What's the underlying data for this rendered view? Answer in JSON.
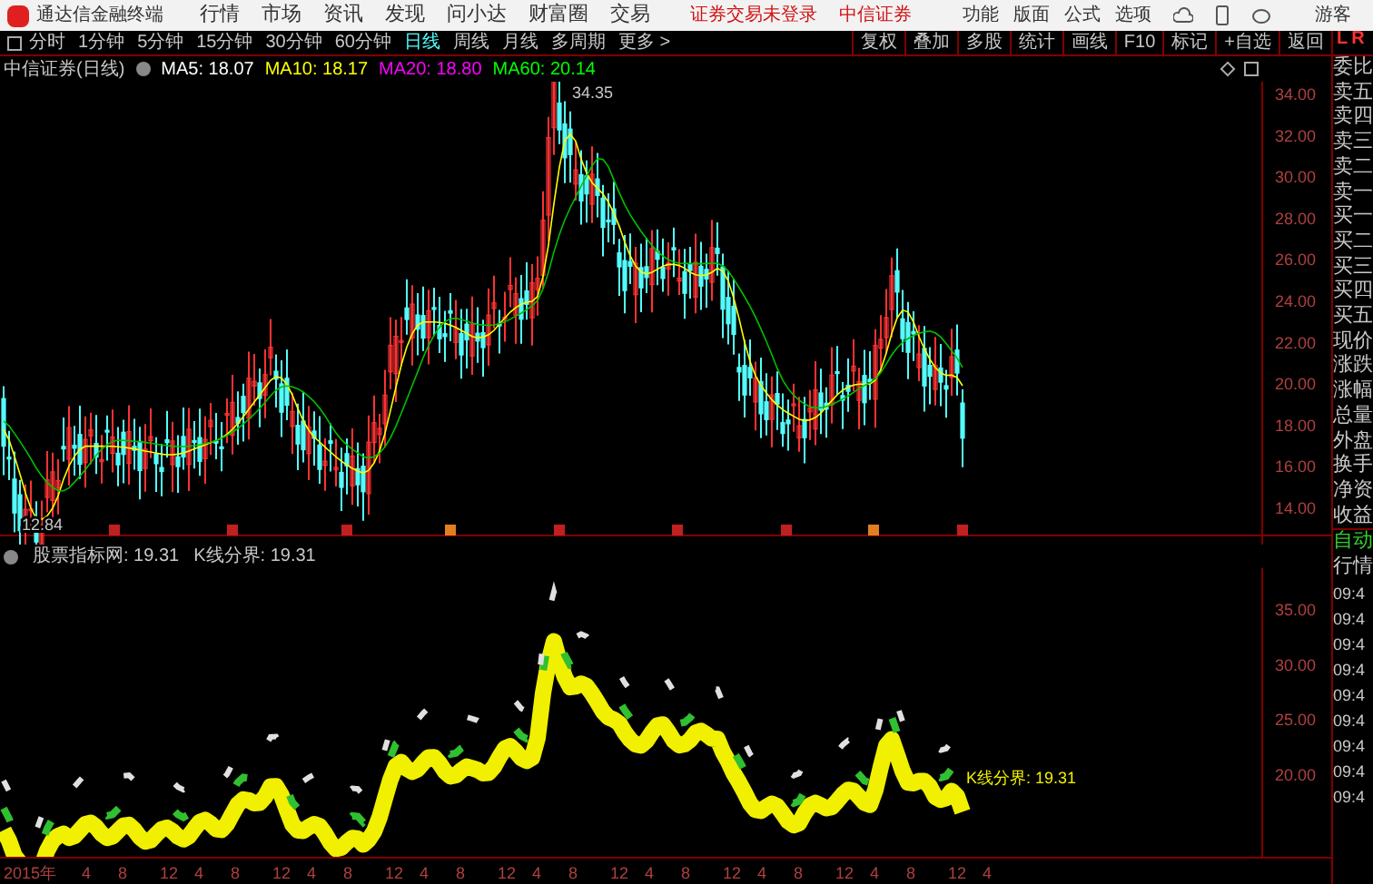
{
  "title_bar": {
    "app_name": "通达信金融终端",
    "menus": [
      "行情",
      "市场",
      "资讯",
      "发现",
      "问小达",
      "财富圈",
      "交易"
    ],
    "login_status": "证券交易未登录",
    "broker": "中信证券",
    "tools": [
      "功能",
      "版面",
      "公式",
      "选项"
    ],
    "user": "游客"
  },
  "period_tabs": [
    {
      "label": "分时",
      "selected": false
    },
    {
      "label": "1分钟",
      "selected": false
    },
    {
      "label": "5分钟",
      "selected": false
    },
    {
      "label": "15分钟",
      "selected": false
    },
    {
      "label": "30分钟",
      "selected": false
    },
    {
      "label": "60分钟",
      "selected": false
    },
    {
      "label": "日线",
      "selected": true
    },
    {
      "label": "周线",
      "selected": false
    },
    {
      "label": "月线",
      "selected": false
    },
    {
      "label": "多周期",
      "selected": false
    },
    {
      "label": "更多 >",
      "selected": false
    }
  ],
  "toolbar_buttons": [
    "复权",
    "叠加",
    "多股",
    "统计",
    "画线",
    "F10",
    "标记",
    "+自选",
    "返回"
  ],
  "side_tabs": [
    "L",
    "R"
  ],
  "legend": {
    "stock": "中信证券(日线)",
    "mas": [
      {
        "label": "MA5: 18.07",
        "color": "#ffffff"
      },
      {
        "label": "MA10: 18.17",
        "color": "#ffff00"
      },
      {
        "label": "MA20: 18.80",
        "color": "#ff00ff"
      },
      {
        "label": "MA60: 20.14",
        "color": "#00ff00"
      }
    ]
  },
  "main_chart": {
    "high_label": "34.35",
    "low_label": "12.84",
    "price_ticks": [
      "34.00",
      "32.00",
      "30.00",
      "28.00",
      "26.00",
      "24.00",
      "22.00",
      "20.00",
      "18.00",
      "16.00",
      "14.00"
    ]
  },
  "indicator": {
    "name": "股票指标网: 19.31",
    "value": "K线分界: 19.31",
    "line_label": "K线分界: 19.31",
    "ticks": [
      "35.00",
      "30.00",
      "25.00",
      "20.00"
    ]
  },
  "date_axis": [
    "2015年",
    "4",
    "8",
    "12",
    "4",
    "8",
    "12",
    "4",
    "8",
    "12",
    "4",
    "8",
    "12",
    "4",
    "8",
    "12",
    "4",
    "8",
    "12",
    "4",
    "8",
    "12",
    "4",
    "8",
    "12",
    "4"
  ],
  "quote_panel": {
    "labels": [
      "委比",
      "卖五",
      "卖四",
      "卖三",
      "卖二",
      "卖一",
      "买一",
      "买二",
      "买三",
      "买四",
      "买五",
      "现价",
      "涨跌",
      "涨幅",
      "总量",
      "外盘",
      "换手",
      "净资",
      "收益"
    ],
    "auto": "自动",
    "quote": "行情",
    "times": [
      "09:4",
      "09:4",
      "09:4",
      "09:4",
      "09:4",
      "09:4",
      "09:4",
      "09:4",
      "09:4"
    ]
  }
}
